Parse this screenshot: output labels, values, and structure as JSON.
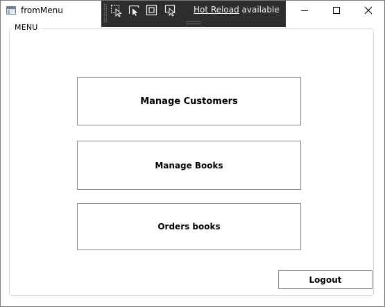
{
  "window": {
    "title": "fromMenu"
  },
  "devbar": {
    "hot_reload_link": "Hot Reload",
    "hot_reload_suffix": " available",
    "chevron": "‹"
  },
  "group": {
    "label": "MENU"
  },
  "buttons": {
    "manage_customers": "Manage Customers",
    "manage_books": "Manage Books",
    "orders_books": "Orders books",
    "logout": "Logout"
  },
  "icons": {
    "app": "app-window-icon",
    "tool1": "select-element-icon",
    "tool2": "pointer-select-icon",
    "tool3": "display-layout-icon",
    "tool4": "track-focus-icon"
  }
}
